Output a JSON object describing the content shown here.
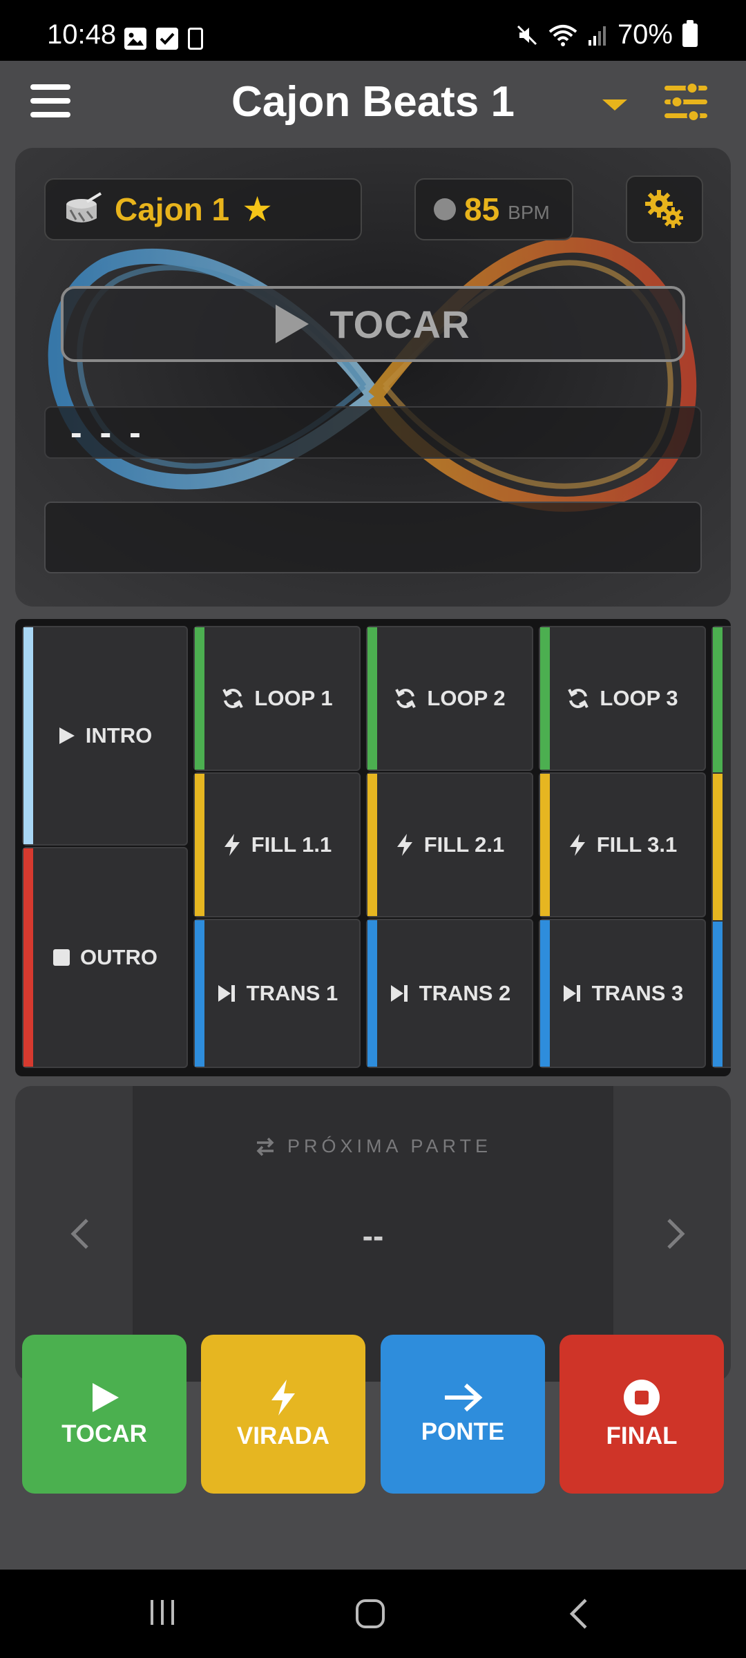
{
  "status_bar": {
    "time": "10:48",
    "battery": "70%",
    "left_icons": [
      "image-icon",
      "check-box-icon",
      "phone-icon"
    ],
    "right_icons": [
      "mute-icon",
      "wifi-icon",
      "signal-icon",
      "battery-icon"
    ]
  },
  "app_bar": {
    "title": "Cajon Beats 1",
    "menu_icon": "hamburger-icon",
    "dropdown_icon": "caret-down-icon",
    "settings_icon": "sliders-icon"
  },
  "hero": {
    "kit_name": "Cajon 1",
    "kit_icon": "drum-icon",
    "favorite_icon": "star-icon",
    "bpm_value": "85",
    "bpm_unit": "BPM",
    "gear_icon": "gears-icon",
    "play_label": "TOCAR",
    "current_part": "- - -",
    "info_field": ""
  },
  "pads": {
    "intro": {
      "label": "INTRO",
      "icon": "play-icon",
      "color": "#a9d7f5"
    },
    "outro": {
      "label": "OUTRO",
      "icon": "stop-icon",
      "color": "#d63a2f"
    },
    "columns": [
      {
        "loop": "LOOP 1",
        "fill": "FILL 1.1",
        "trans": "TRANS 1"
      },
      {
        "loop": "LOOP 2",
        "fill": "FILL 2.1",
        "trans": "TRANS 2"
      },
      {
        "loop": "LOOP 3",
        "fill": "FILL 3.1",
        "trans": "TRANS 3"
      }
    ],
    "colors": {
      "loop": "#4caf50",
      "fill": "#e6b621",
      "trans": "#2e8ddc"
    }
  },
  "next_part": {
    "heading": "PRÓXIMA PARTE",
    "value": "--",
    "prev_icon": "chevron-left-icon",
    "next_icon": "chevron-right-icon"
  },
  "actions": {
    "play": "TOCAR",
    "fill": "VIRADA",
    "bridge": "PONTE",
    "end": "FINAL"
  },
  "colors": {
    "accent": "#e8b41c",
    "background": "#4a4a4c"
  }
}
